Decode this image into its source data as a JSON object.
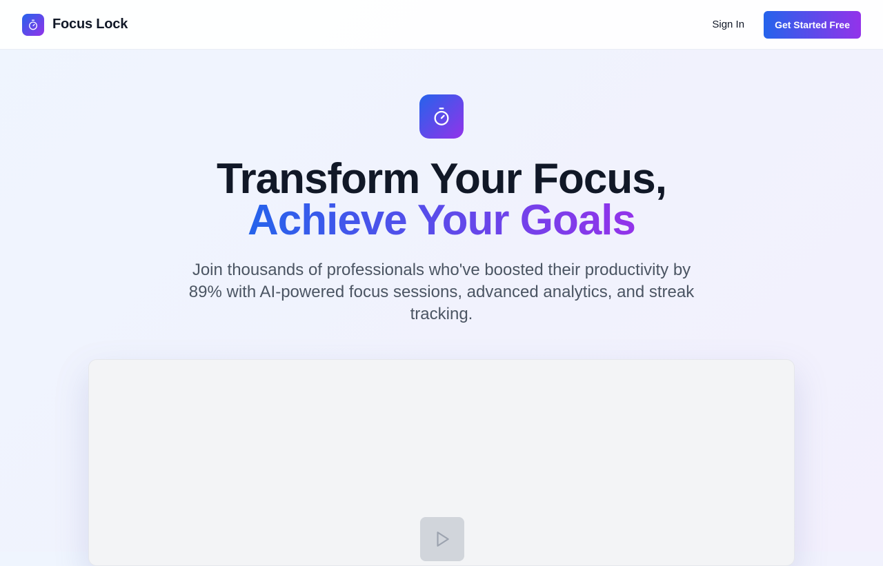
{
  "brand": {
    "name": "Focus Lock",
    "logo_icon": "stopwatch-icon"
  },
  "nav": {
    "sign_in": "Sign In",
    "cta": "Get Started Free"
  },
  "hero": {
    "icon": "stopwatch-icon",
    "headline_line1": "Transform Your Focus,",
    "headline_line2": "Achieve Your Goals",
    "subtitle": "Join thousands of professionals who've boosted their productivity by 89% with AI-powered focus sessions, advanced analytics, and streak tracking."
  },
  "video": {
    "play_icon": "play-icon"
  },
  "colors": {
    "gradient_start": "#2563eb",
    "gradient_end": "#9333ea",
    "heading": "#111827",
    "body_text": "#4b5563",
    "video_bg": "#f3f4f6"
  }
}
